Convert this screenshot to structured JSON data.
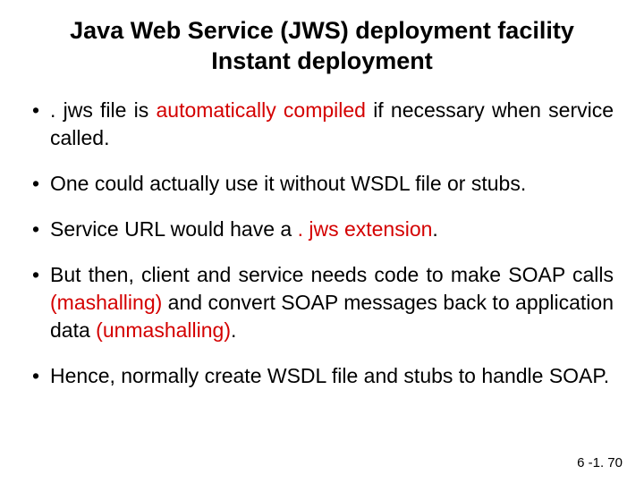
{
  "title_line1": "Java Web Service (JWS) deployment facility",
  "title_line2": "Instant deployment",
  "bullets": {
    "b1a": ". jws  file is ",
    "b1b": "automatically compiled",
    "b1c": " if necessary when service called.",
    "b2": "One could actually use it without WSDL file or stubs.",
    "b3a": "Service URL would have a ",
    "b3b": ". jws extension",
    "b3c": ".",
    "b4a": " But then, client and service needs code to make SOAP calls ",
    "b4b": "(mashalling)",
    "b4c": " and convert SOAP messages back to application data ",
    "b4d": "(unmashalling)",
    "b4e": ".",
    "b5": "Hence, normally create WSDL file and stubs to handle SOAP."
  },
  "footer": "6 -1. 70"
}
